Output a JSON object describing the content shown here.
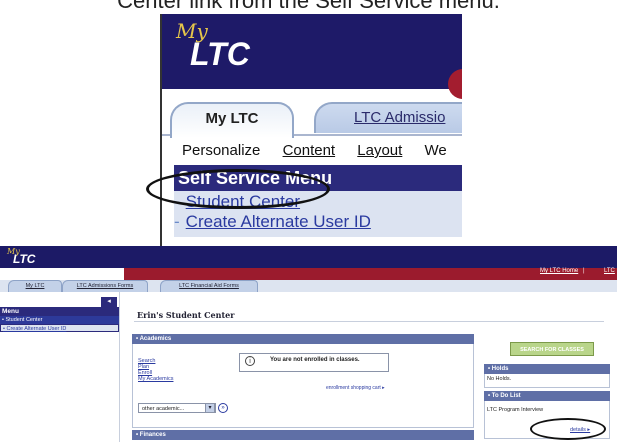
{
  "caption": "Center link from the Self Service menu.",
  "inset": {
    "logo_my": "My",
    "logo_ltc": "LTC",
    "tabs": [
      "My LTC",
      "LTC Admissio"
    ],
    "links": [
      "Personalize",
      "Content",
      "Layout",
      "We"
    ],
    "menu_title": "Self Service Menu",
    "menu_items": [
      "Student Center",
      "Create Alternate User ID"
    ]
  },
  "screen": {
    "logo_my": "My",
    "logo_ltc": "LTC",
    "top_nav": [
      "My LTC Home",
      "|",
      "LTC"
    ],
    "tabs": [
      "My LTC",
      "LTC Admissions Forms",
      "LTC Financial Aid Forms"
    ],
    "menu_title": "Menu",
    "menu_items": [
      "Student Center",
      "Create Alternate User ID"
    ],
    "page_title": "Erin's Student Center",
    "academics": {
      "header": "Academics",
      "links": [
        "Search",
        "Plan",
        "Enroll",
        "My Academics"
      ],
      "notice": "You are not enrolled in classes.",
      "cart_link": "enrollment shopping cart ▸",
      "select_value": "other academic...",
      "select_arrow": "▾",
      "go_button": "»"
    },
    "finances_header": "Finances",
    "search_button": "SEARCH FOR CLASSES",
    "holds": {
      "header": "Holds",
      "text": "No Holds."
    },
    "todo": {
      "header": "To Do List",
      "item": "LTC Program Interview",
      "details_link": "details ▸"
    },
    "collapse_icon": "◂",
    "info_icon": "i",
    "bullet": "•"
  },
  "colors": {
    "banner": "#1c1a66",
    "menu_header": "#2b2a7c",
    "accent_red": "#9b1b2d",
    "section_header": "#5f6fa6",
    "search_button": "#b9d58a"
  }
}
